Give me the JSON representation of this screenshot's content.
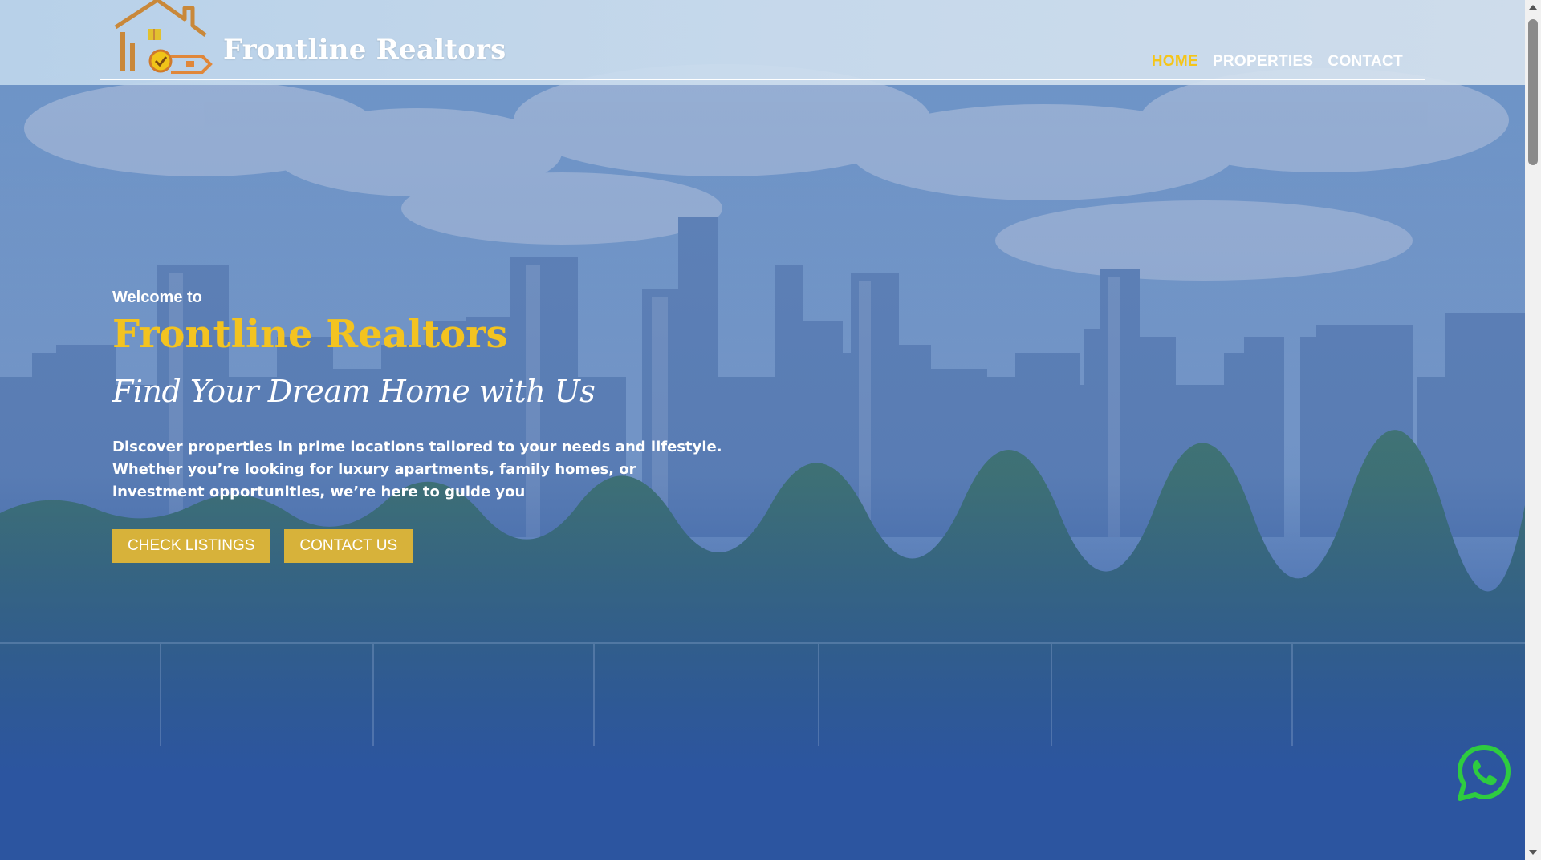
{
  "header": {
    "brand_name": "Frontline Realtors",
    "nav": [
      {
        "label": "HOME",
        "active": true
      },
      {
        "label": "PROPERTIES",
        "active": false
      },
      {
        "label": "CONTACT",
        "active": false
      }
    ]
  },
  "hero": {
    "welcome": "Welcome to",
    "title": "Frontline Realtors",
    "tagline": "Find Your Dream Home with Us",
    "description": "Discover properties in prime locations tailored to your needs and lifestyle. Whether you’re looking for luxury apartments, family homes, or investment opportunities, we’re here to guide you",
    "buttons": {
      "primary": "CHECK LISTINGS",
      "secondary": "CONTACT US"
    }
  },
  "floating": {
    "whatsapp_icon": "whatsapp-icon"
  },
  "colors": {
    "accent_gold": "#f3c320",
    "button_gold": "#d7b23a",
    "overlay_blue": "#2c55a0",
    "whatsapp_green": "#2ecc40"
  }
}
